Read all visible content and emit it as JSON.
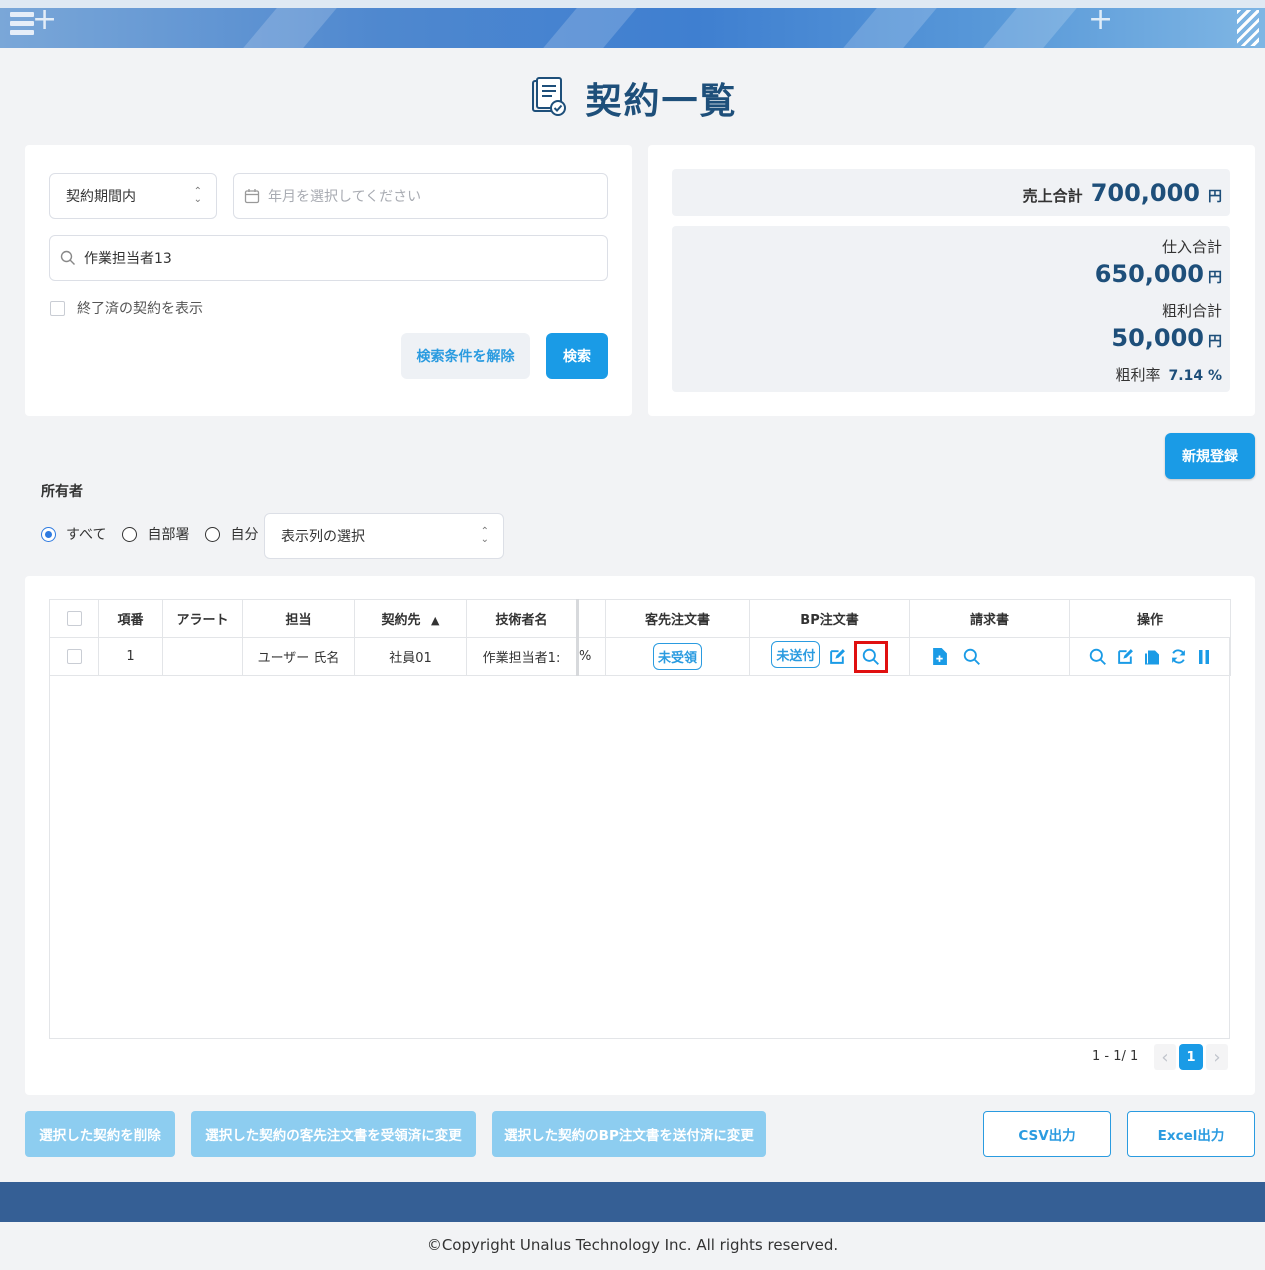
{
  "page": {
    "title": "契約一覧"
  },
  "search": {
    "period_select": "契約期間内",
    "month_placeholder": "年月を選択してください",
    "keyword_value": "作業担当者13",
    "show_finished_label": "終了済の契約を表示",
    "clear_button": "検索条件を解除",
    "search_button": "検索"
  },
  "totals": {
    "sales_label": "売上合計",
    "sales_value": "700,000",
    "purchase_label": "仕入合計",
    "purchase_value": "650,000",
    "profit_label": "粗利合計",
    "profit_value": "50,000",
    "rate_label": "粗利率",
    "rate_value": "7.14 %",
    "currency": "円"
  },
  "new_button": "新規登録",
  "owner": {
    "label": "所有者",
    "options": [
      "すべて",
      "自部署",
      "自分"
    ],
    "selected": "すべて",
    "columns_select": "表示列の選択"
  },
  "table": {
    "headers": [
      "項番",
      "アラート",
      "担当",
      "契約先",
      "技術者名",
      "客先注文書",
      "BP注文書",
      "請求書",
      "操作"
    ],
    "sort_indicator": "▲",
    "rows": [
      {
        "no": "1",
        "alert": "",
        "owner": "ユーザー 氏名",
        "client": "社員01",
        "engineer": "作業担当者1:",
        "pct": "%",
        "client_order": "未受領",
        "bp_order": "未送付"
      }
    ]
  },
  "pagination": {
    "range": "1 - 1/ 1",
    "current": "1",
    "prev": "‹",
    "next": "›"
  },
  "actions": {
    "delete": "選択した契約を削除",
    "client_received": "選択した契約の客先注文書を受領済に変更",
    "bp_sent": "選択した契約のBP注文書を送付済に変更",
    "csv": "CSV出力",
    "excel": "Excel出力"
  },
  "footer": {
    "copyright": "©Copyright Unalus Technology Inc. All rights reserved."
  },
  "colors": {
    "accent": "#1a9be6",
    "title": "#1e4f7a",
    "footer": "#355f95",
    "highlight": "#e01010"
  }
}
